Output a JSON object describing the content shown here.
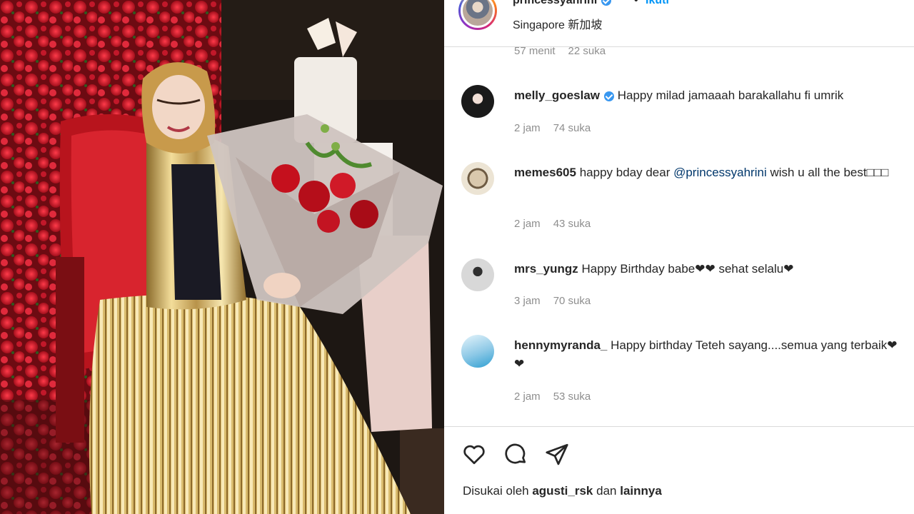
{
  "post_header": {
    "username": "princessyahrini",
    "separator": "•",
    "follow_label": "Ikuti",
    "location": "Singapore 新加坡"
  },
  "top_meta": {
    "time": "57 menit",
    "likes": "22 suka"
  },
  "comments": [
    {
      "username": "melly_goeslaw",
      "verified": true,
      "text": "Happy milad jamaaah barakallahu fi umrik",
      "time": "2 jam",
      "likes": "74 suka"
    },
    {
      "username": "memes605",
      "text_before": "happy bday dear ",
      "mention": "@princessyahrini",
      "text_after": " wish u all the best□□□",
      "time": "2 jam",
      "likes": "43 suka"
    },
    {
      "username": "mrs_yungz",
      "text": "Happy Birthday babe❤❤ sehat selalu❤",
      "time": "3 jam",
      "likes": "70 suka"
    },
    {
      "username": "hennymyranda_",
      "text": "Happy birthday Teteh sayang....semua yang terbaik❤❤",
      "time": "2 jam",
      "likes": "53 suka"
    }
  ],
  "actions": {
    "icons": [
      "heart-icon",
      "comment-icon",
      "share-icon"
    ],
    "liked_by_prefix": "Disukai oleh",
    "liked_by_user": "agusti_rsk",
    "liked_by_and": "dan",
    "liked_by_others": "lainnya"
  },
  "colors": {
    "link": "#0095f6",
    "mention": "#00376b",
    "muted": "#8e8e8e",
    "verified": "#3897f0",
    "divider": "#dbdbdb"
  }
}
